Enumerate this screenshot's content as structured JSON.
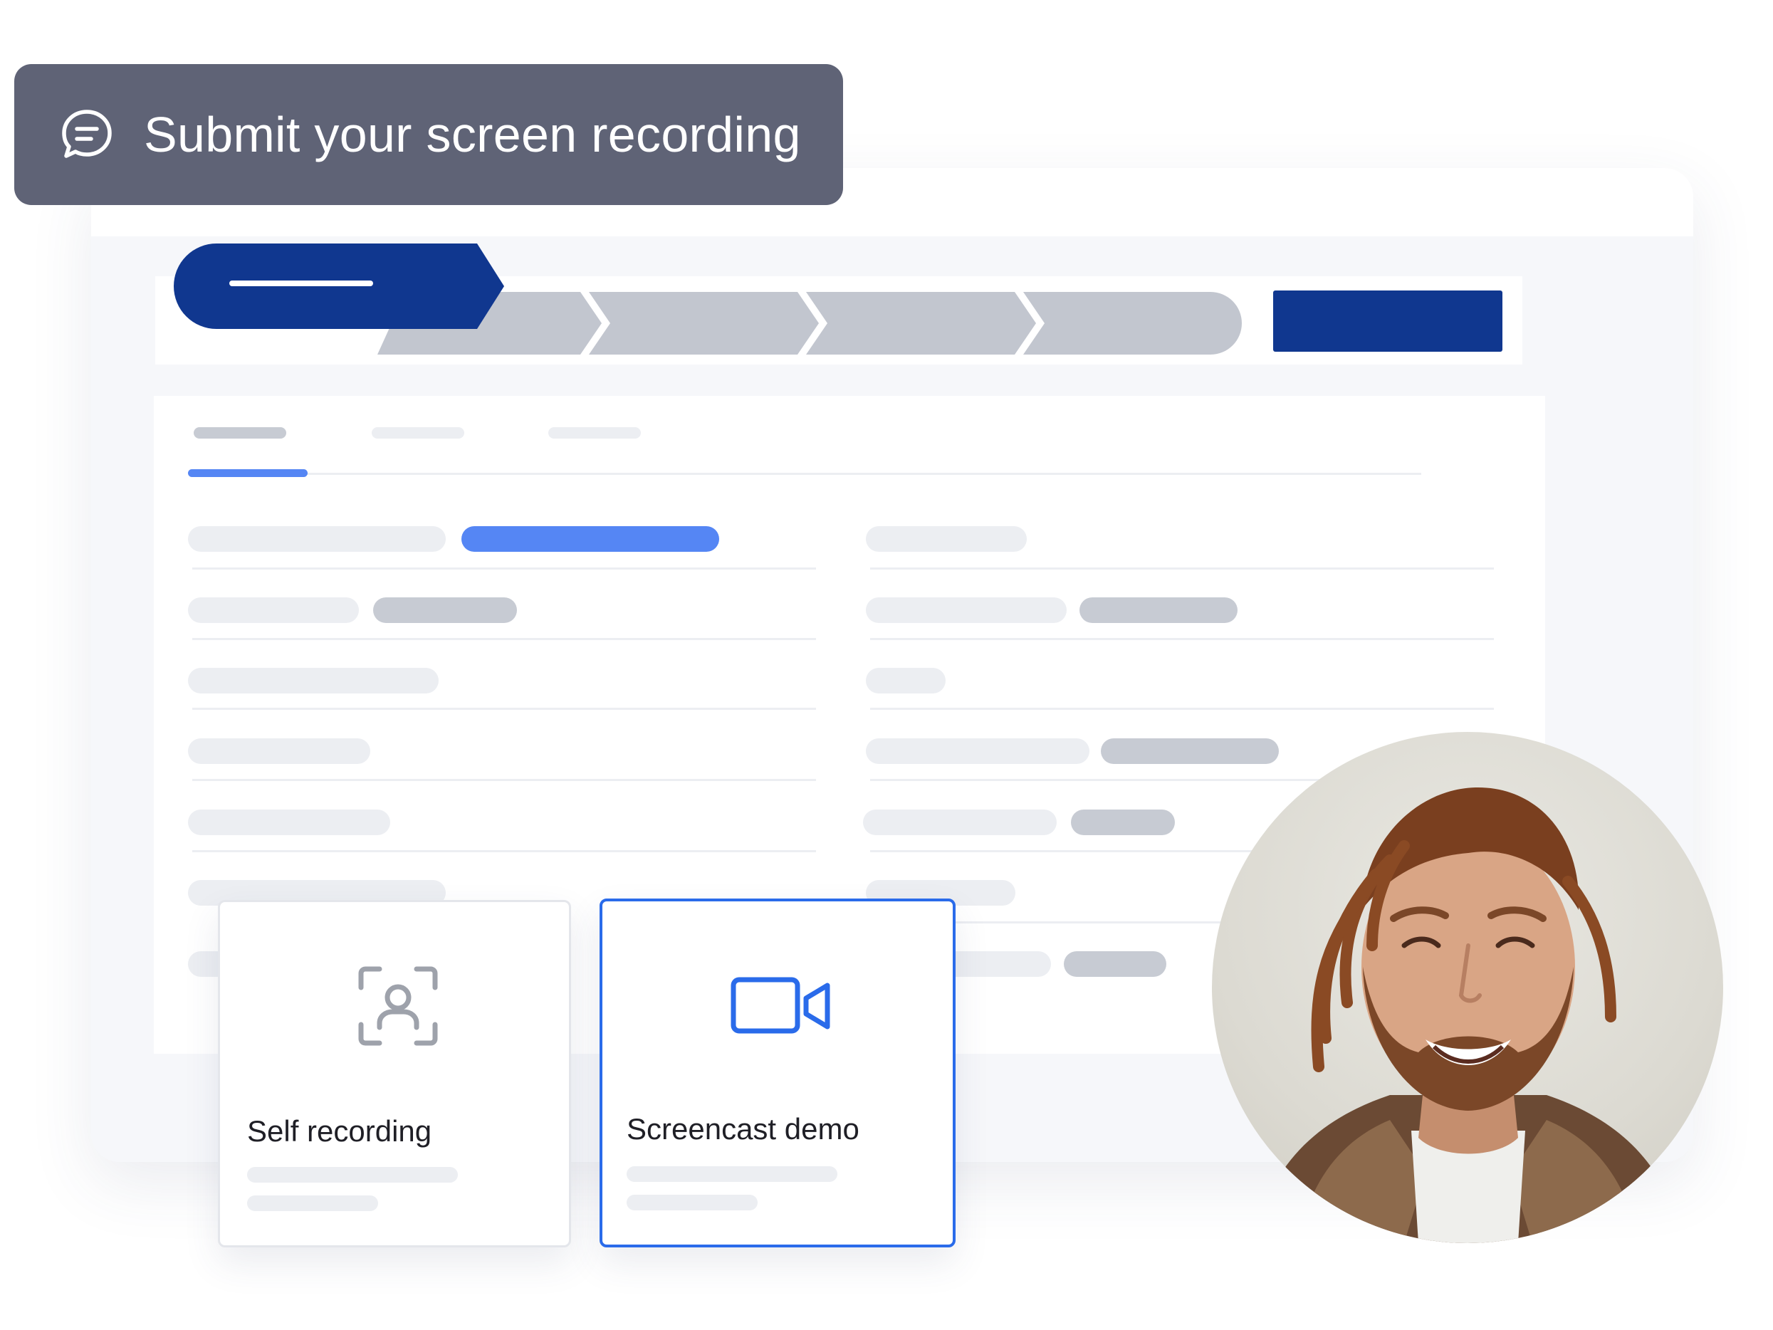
{
  "banner": {
    "icon": "chat-bubble-icon",
    "title": "Submit your screen recording",
    "background_color": "#5f6376"
  },
  "stepper": {
    "active_color": "#10378f",
    "inactive_color": "#c2c6cf",
    "step_count": 5,
    "active_step": 1
  },
  "options": [
    {
      "label": "Self recording",
      "icon": "person-frame-icon",
      "selected": false
    },
    {
      "label": "Screencast demo",
      "icon": "video-camera-icon",
      "selected": true
    }
  ],
  "colors": {
    "brand_navy": "#10378f",
    "accent_blue": "#2a6bea",
    "highlight_blue": "#5586f4"
  },
  "avatar": {
    "description_icon": "user-photo"
  }
}
